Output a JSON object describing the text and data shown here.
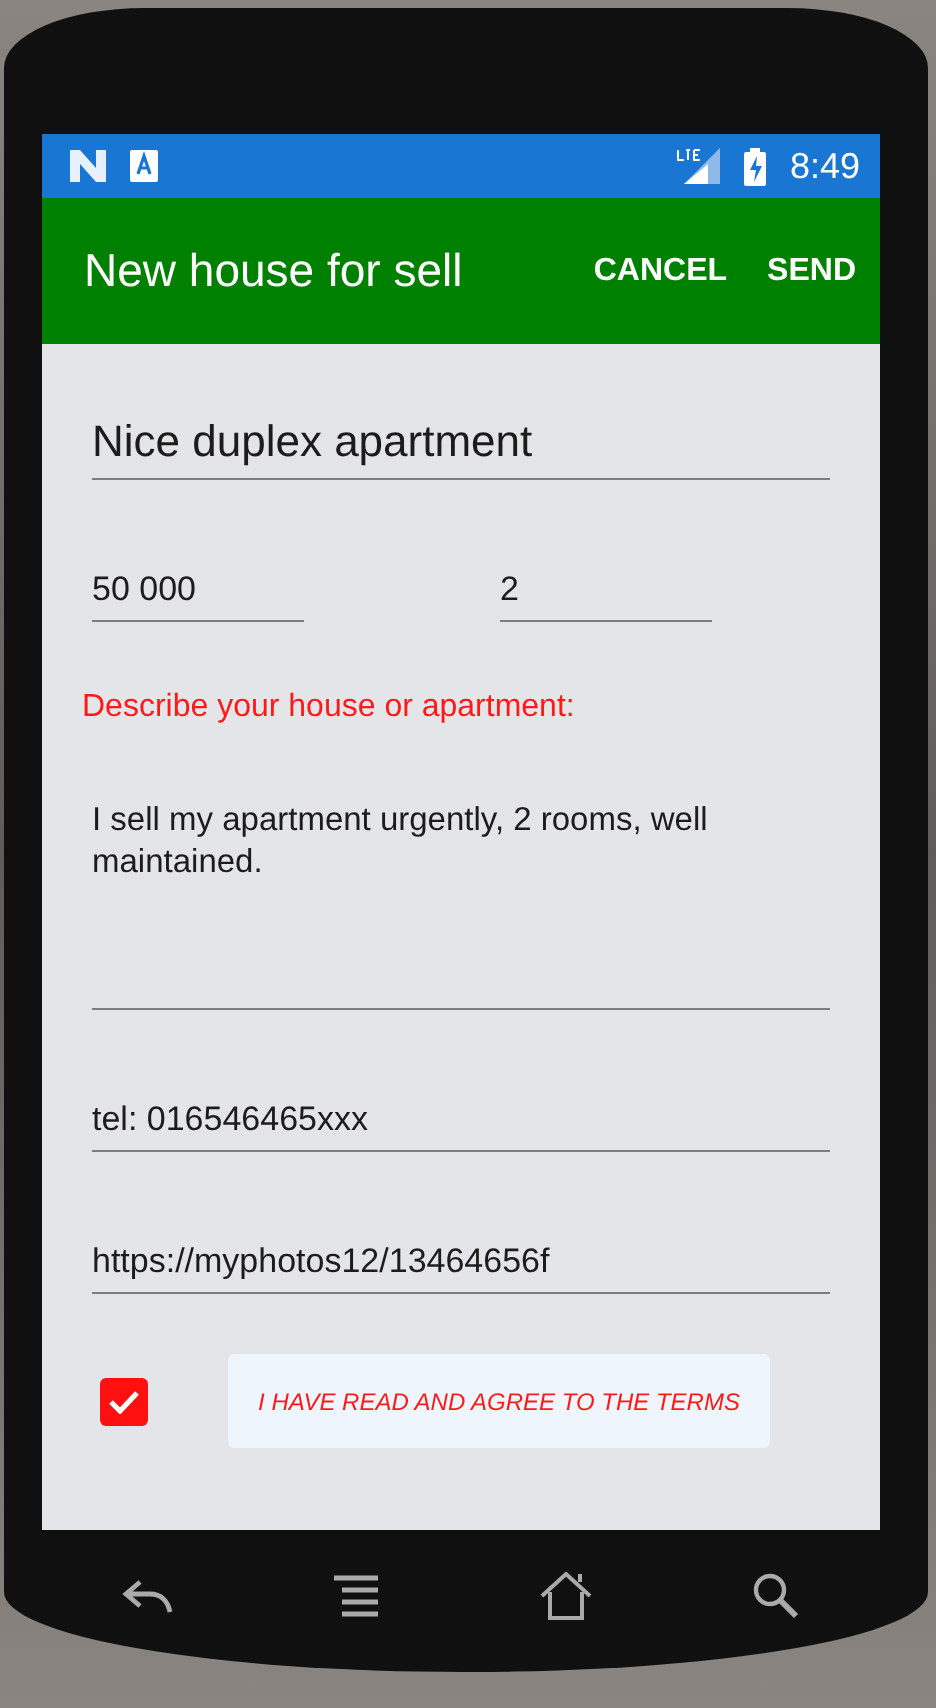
{
  "status_bar": {
    "time": "8:49"
  },
  "app_bar": {
    "title": "New house for sell",
    "actions": [
      "CANCEL",
      "SEND"
    ]
  },
  "title_field": {
    "value": "Nice duplex apartment"
  },
  "price_field": {
    "value": "50 000"
  },
  "rooms_field": {
    "value": "2"
  },
  "description_label": "Describe your house or apartment:",
  "description_field": {
    "value": "I sell my apartment urgently, 2 rooms, well maintained."
  },
  "phone_field": {
    "value": "tel: 016546465xxx"
  },
  "url_field": {
    "value": "https://myphotos12/13464656f"
  },
  "terms": {
    "checked": true,
    "label": "I HAVE READ AND AGREE TO THE TERMS"
  }
}
